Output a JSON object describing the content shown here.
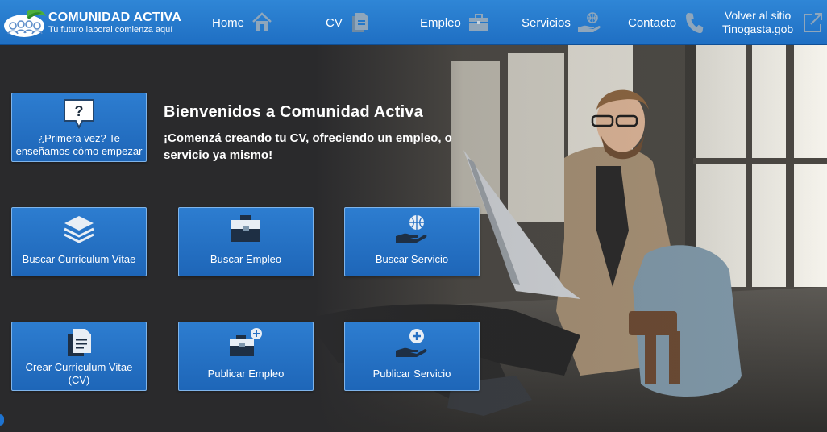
{
  "brand": {
    "name": "COMUNIDAD ACTIVA",
    "tagline": "Tu futuro laboral comienza aquí",
    "logo_icon": "community-people-logo-icon"
  },
  "nav": {
    "home": {
      "label": "Home",
      "icon": "house-icon"
    },
    "cv": {
      "label": "CV",
      "icon": "document-icon"
    },
    "empleo": {
      "label": "Empleo",
      "icon": "briefcase-icon"
    },
    "servicios": {
      "label": "Servicios",
      "icon": "globe-hand-icon"
    },
    "contacto": {
      "label": "Contacto",
      "icon": "phone-icon"
    },
    "back": {
      "label_line1": "Volver al sitio",
      "label_line2": "Tinogasta.gob",
      "icon": "external-link-icon"
    }
  },
  "hero": {
    "title": "Bienvenidos a Comunidad Activa",
    "subtitle": "¡Comenzá creando tu CV, ofreciendo un empleo, o servicio ya mismo!"
  },
  "tiles": {
    "help": {
      "label": "¿Primera vez? Te enseñamos cómo empezar",
      "icon": "question-bubble-icon"
    },
    "buscar_cv": {
      "label": "Buscar Currículum Vitae",
      "icon": "layers-icon"
    },
    "buscar_empleo": {
      "label": "Buscar Empleo",
      "icon": "briefcase-icon"
    },
    "buscar_servicio": {
      "label": "Buscar Servicio",
      "icon": "globe-hand-icon"
    },
    "crear_cv": {
      "label": "Crear Currículum Vitae (CV)",
      "icon": "document-copy-icon"
    },
    "publicar_empleo": {
      "label": "Publicar Empleo",
      "icon": "briefcase-plus-icon"
    },
    "publicar_servicio": {
      "label": "Publicar Servicio",
      "icon": "hand-plus-icon"
    }
  },
  "colors": {
    "navbar": "#2478c9",
    "tile": "#2670c3",
    "tile_border": "#7fb4ea",
    "icon_gray": "#7f97ad",
    "text": "#ffffff"
  }
}
